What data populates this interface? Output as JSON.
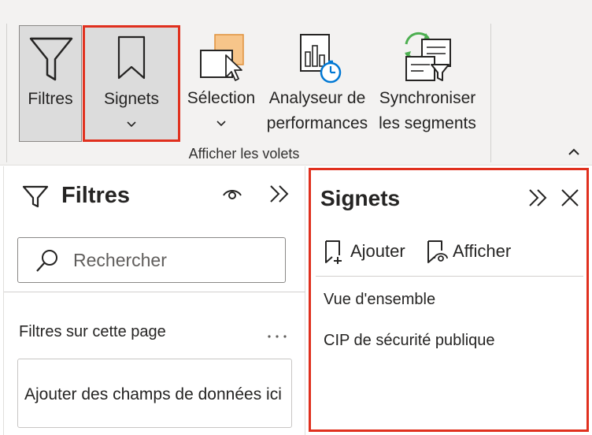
{
  "ribbon": {
    "buttons": [
      {
        "label": "Filtres"
      },
      {
        "label": "Signets"
      },
      {
        "label": "Sélection"
      },
      {
        "label_line1": "Analyseur de",
        "label_line2": "performances"
      },
      {
        "label_line1": "Synchroniser",
        "label_line2": "les segments"
      }
    ],
    "group_label": "Afficher les volets"
  },
  "filters_pane": {
    "title": "Filtres",
    "search_placeholder": "Rechercher",
    "section_label": "Filtres sur cette page",
    "more_icon": "ellipsis-icon",
    "drop_well_text": "Ajouter des champs de données ici"
  },
  "bookmarks_pane": {
    "title": "Signets",
    "actions": [
      {
        "label": "Ajouter",
        "icon": "add-bookmark-icon"
      },
      {
        "label": "Afficher",
        "icon": "view-bookmark-icon"
      }
    ],
    "items": [
      {
        "label": "Vue d'ensemble"
      },
      {
        "label": "CIP de sécurité publique"
      }
    ]
  },
  "colors": {
    "highlight_border": "#e0301e",
    "ribbon_bg": "#f3f2f1",
    "selected_button_bg": "#dcdcdc",
    "accent_teal": "#0f7b6c",
    "accent_green": "#4caf50",
    "accent_blue": "#0078d4",
    "accent_orange": "#f7b541"
  }
}
